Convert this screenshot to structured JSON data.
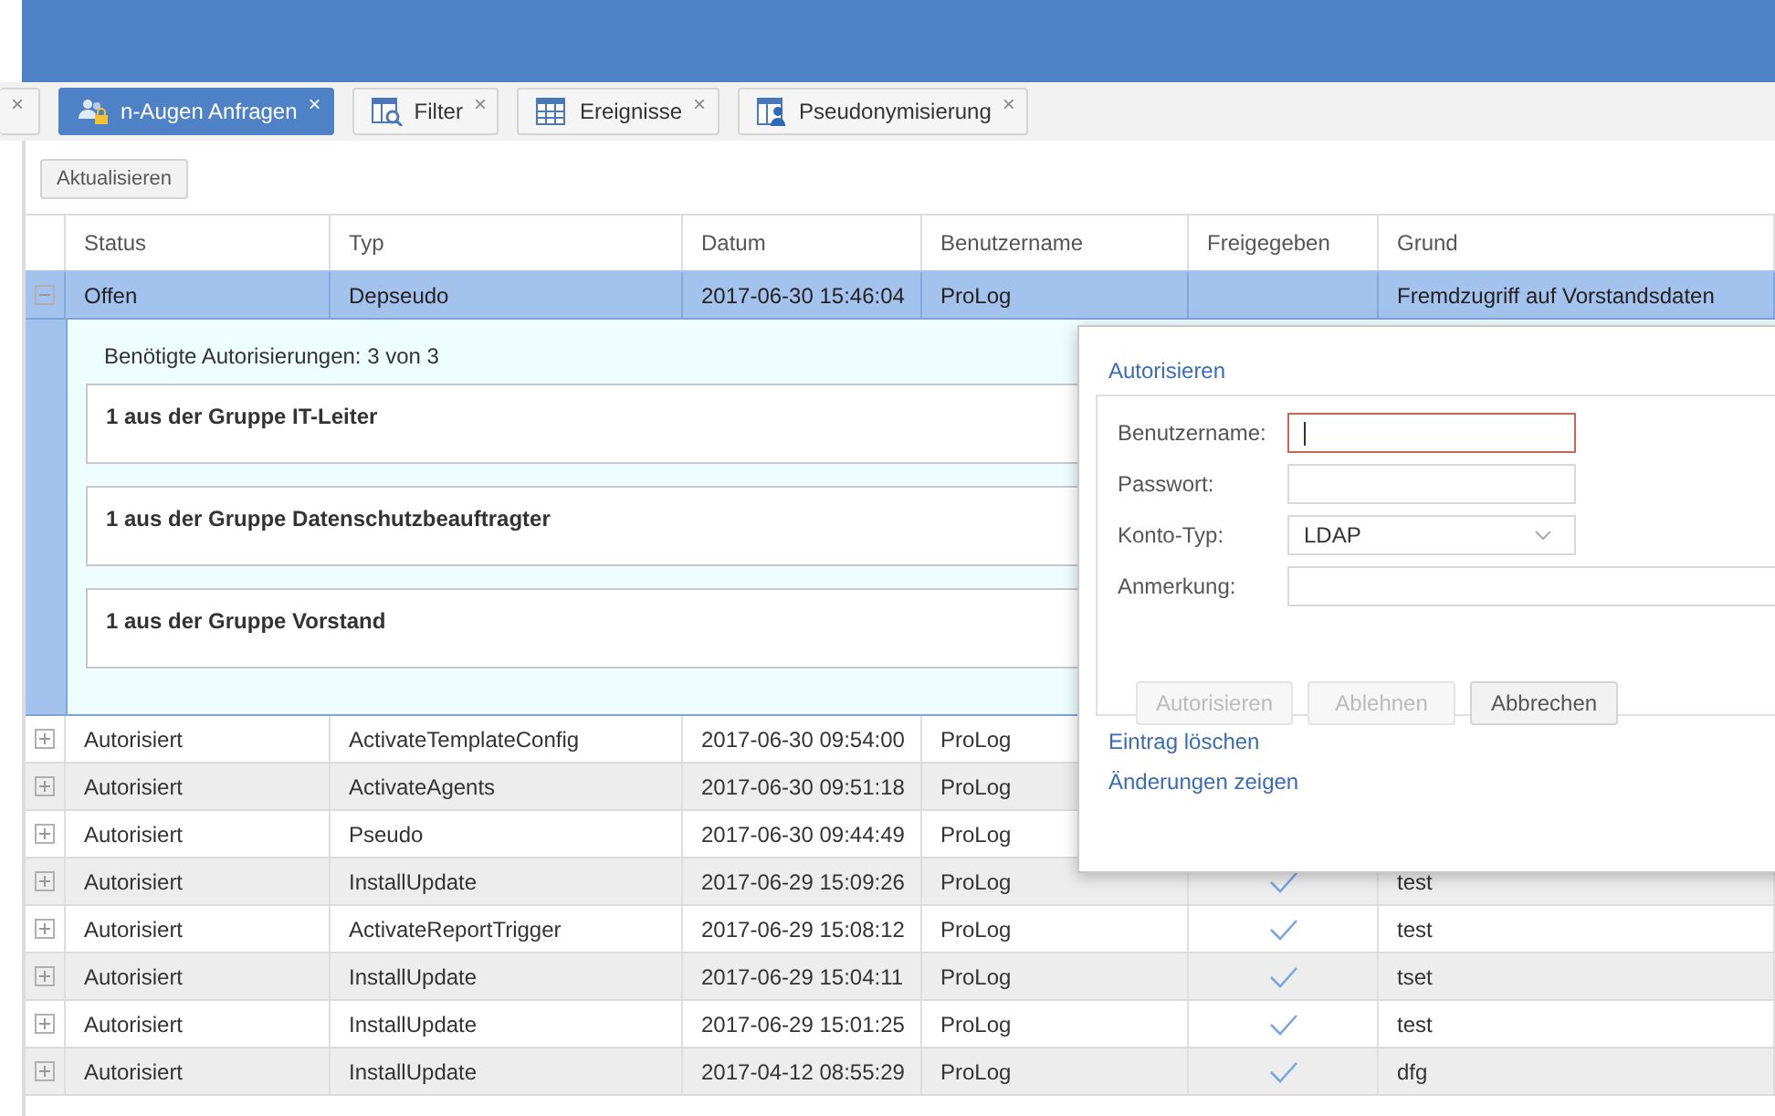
{
  "tabs": [
    {
      "kind": "cut",
      "close": "×",
      "selected": false
    },
    {
      "kind": "users",
      "label": "n-Augen Anfragen",
      "close": "×",
      "selected": true
    },
    {
      "kind": "filter",
      "label": "Filter",
      "close": "×",
      "selected": false
    },
    {
      "kind": "table",
      "label": "Ereignisse",
      "close": "×",
      "selected": false
    },
    {
      "kind": "person",
      "label": "Pseudonymisierung",
      "close": "×",
      "selected": false
    }
  ],
  "toolbar": {
    "refresh_button": "Aktualisieren"
  },
  "table": {
    "columns": [
      "Status",
      "Typ",
      "Datum",
      "Benutzername",
      "Freigegeben",
      "Grund"
    ],
    "rows": [
      {
        "status": "Offen",
        "type": "Depseudo",
        "date": "2017-06-30 15:46:04",
        "user": "ProLog",
        "reason": "Fremdzugriff auf Vorstandsdaten",
        "selected": true,
        "expanded": true,
        "details": {
          "summary": "Benötigte Autorisierungen: 3 von 3",
          "groups": [
            "1 aus der Gruppe IT-Leiter",
            "1 aus der Gruppe Datenschutzbeauftragter",
            "1 aus der Gruppe Vorstand"
          ]
        }
      },
      {
        "status": "Autorisiert",
        "type": "ActivateTemplateConfig",
        "date": "2017-06-30 09:54:00",
        "user": "ProLog",
        "selected": false,
        "expanded": false
      },
      {
        "status": "Autorisiert",
        "type": "ActivateAgents",
        "date": "2017-06-30 09:51:18",
        "user": "ProLog",
        "selected": false,
        "expanded": false
      },
      {
        "status": "Autorisiert",
        "type": "Pseudo",
        "date": "2017-06-30 09:44:49",
        "user": "ProLog",
        "selected": false,
        "expanded": false
      },
      {
        "status": "Autorisiert",
        "type": "InstallUpdate",
        "date": "2017-06-29 15:09:26",
        "user": "ProLog",
        "approved": true,
        "reason": "test",
        "selected": false,
        "expanded": false
      },
      {
        "status": "Autorisiert",
        "type": "ActivateReportTrigger",
        "date": "2017-06-29 15:08:12",
        "user": "ProLog",
        "approved": true,
        "reason": "test",
        "selected": false,
        "expanded": false
      },
      {
        "status": "Autorisiert",
        "type": "InstallUpdate",
        "date": "2017-06-29 15:04:11",
        "user": "ProLog",
        "approved": true,
        "reason": "tset",
        "selected": false,
        "expanded": false
      },
      {
        "status": "Autorisiert",
        "type": "InstallUpdate",
        "date": "2017-06-29 15:01:25",
        "user": "ProLog",
        "approved": true,
        "reason": "test",
        "selected": false,
        "expanded": false
      },
      {
        "status": "Autorisiert",
        "type": "InstallUpdate",
        "date": "2017-04-12 08:55:29",
        "user": "ProLog",
        "approved": true,
        "reason": "dfg",
        "selected": false,
        "expanded": false
      }
    ]
  },
  "popup": {
    "title": "Autorisieren",
    "fields": [
      {
        "label": "Benutzername:",
        "kind": "text",
        "focused": true
      },
      {
        "label": "Passwort:",
        "kind": "password",
        "focused": false
      },
      {
        "label": "Konto-Typ:",
        "kind": "select",
        "value": "LDAP",
        "focused": false
      },
      {
        "label": "Anmerkung:",
        "kind": "wide",
        "focused": false
      }
    ],
    "buttons": [
      {
        "label": "Autorisieren",
        "disabled": true
      },
      {
        "label": "Ablehnen",
        "disabled": true
      },
      {
        "label": "Abbrechen",
        "disabled": false
      }
    ],
    "links": [
      "Eintrag löschen",
      "Änderungen zeigen"
    ]
  }
}
